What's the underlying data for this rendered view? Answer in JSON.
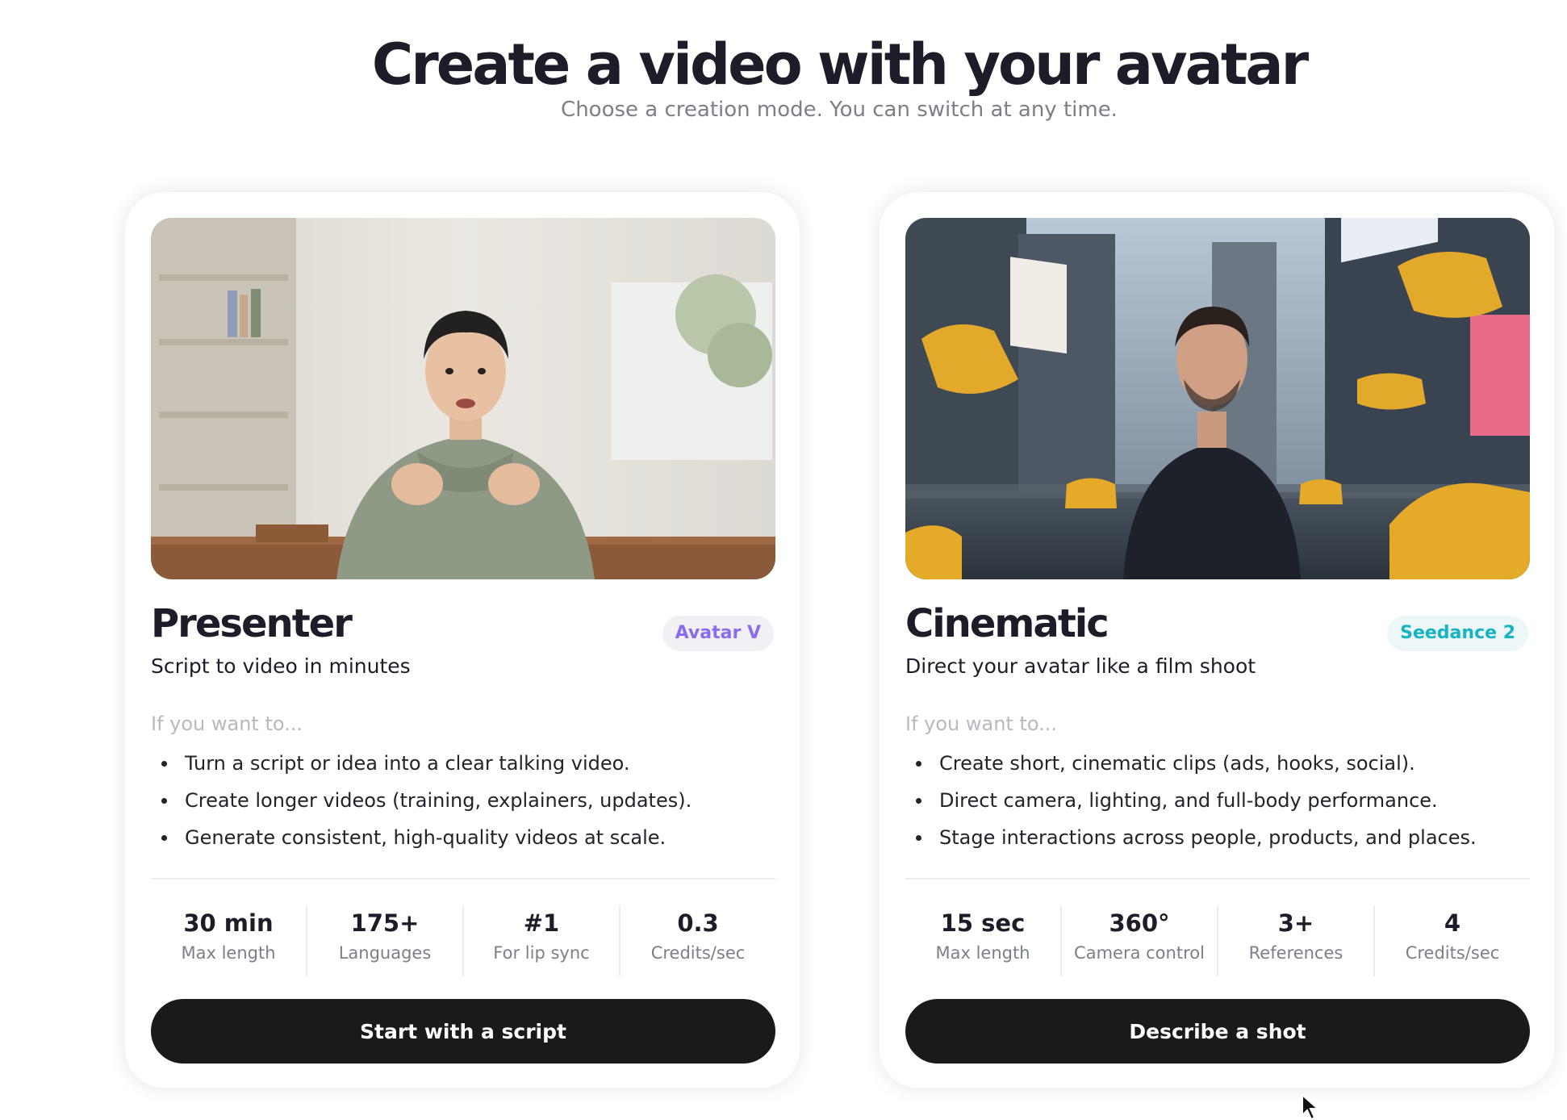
{
  "header": {
    "title": "Create a video with your avatar",
    "subtitle": "Choose a creation mode. You can switch at any time."
  },
  "cards": [
    {
      "title": "Presenter",
      "badge": "Avatar V",
      "tagline": "Script to video in minutes",
      "want_label": "If you want to...",
      "bullets": [
        "Turn a script or idea into a clear talking video.",
        "Create longer videos (training, explainers, updates).",
        "Generate consistent, high-quality videos at scale."
      ],
      "stats": [
        {
          "value": "30 min",
          "label": "Max length"
        },
        {
          "value": "175+",
          "label": "Languages"
        },
        {
          "value": "#1",
          "label": "For lip sync"
        },
        {
          "value": "0.3",
          "label": "Credits/sec"
        }
      ],
      "cta": "Start with a script"
    },
    {
      "title": "Cinematic",
      "badge": "Seedance 2",
      "tagline": "Direct your avatar like a film shoot",
      "want_label": "If you want to...",
      "bullets": [
        "Create short, cinematic clips (ads, hooks, social).",
        "Direct camera, lighting, and full-body performance.",
        "Stage interactions across people, products, and places."
      ],
      "stats": [
        {
          "value": "15 sec",
          "label": "Max length"
        },
        {
          "value": "360°",
          "label": "Camera control"
        },
        {
          "value": "3+",
          "label": "References"
        },
        {
          "value": "4",
          "label": "Credits/sec"
        }
      ],
      "cta": "Describe a shot"
    }
  ],
  "colors": {
    "badge_presenter": "#8a6cf0",
    "badge_cinematic": "#15b3c4",
    "cta_background": "#1a1a1a"
  }
}
